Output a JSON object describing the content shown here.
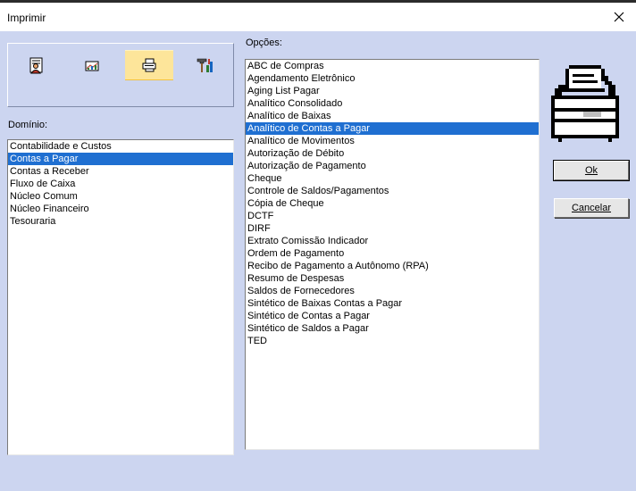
{
  "window": {
    "title": "Imprimir"
  },
  "toolbar": {
    "buttons": [
      {
        "name": "report-person-icon",
        "active": false
      },
      {
        "name": "chart-report-icon",
        "active": false
      },
      {
        "name": "printer-icon",
        "active": true
      },
      {
        "name": "tools-icon",
        "active": false
      }
    ]
  },
  "domain": {
    "label": "Domínio:",
    "items": [
      "Contabilidade e Custos",
      "Contas a Pagar",
      "Contas a Receber",
      "Fluxo de Caixa",
      "Núcleo Comum",
      "Núcleo Financeiro",
      "Tesouraria"
    ],
    "selected_index": 1
  },
  "options": {
    "label": "Opções:",
    "items": [
      "ABC de Compras",
      "Agendamento Eletrônico",
      "Aging List Pagar",
      "Analítico Consolidado",
      "Analítico de Baixas",
      "Analítico de Contas a Pagar",
      "Analítico de Movimentos",
      "Autorização de Débito",
      "Autorização de Pagamento",
      "Cheque",
      "Controle de Saldos/Pagamentos",
      "Cópia de Cheque",
      "DCTF",
      "DIRF",
      "Extrato Comissão Indicador",
      "Ordem de Pagamento",
      "Recibo de Pagamento a Autônomo (RPA)",
      "Resumo de Despesas",
      "Saldos de Fornecedores",
      "Sintético de Baixas Contas a Pagar",
      "Sintético de Contas a Pagar",
      "Sintético de Saldos a Pagar",
      "TED"
    ],
    "selected_index": 5
  },
  "buttons": {
    "ok_label": "Ok",
    "cancel_label": "Cancelar"
  }
}
